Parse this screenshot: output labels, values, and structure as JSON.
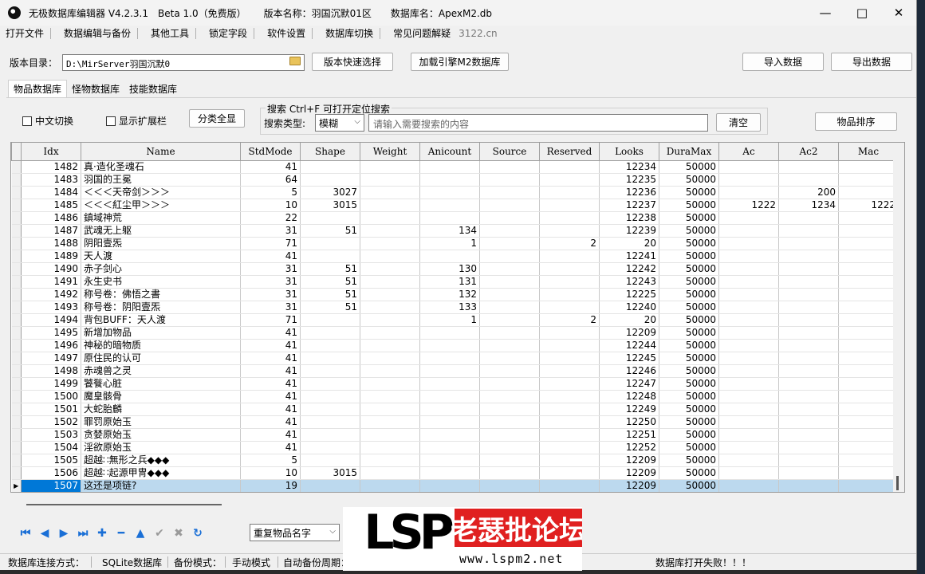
{
  "window": {
    "title_app": "无极数据库编辑器 V4.2.3.1",
    "title_beta": "Beta 1.0（免费版）",
    "title_version": "版本名称：羽国沉默01区",
    "title_db": "数据库名：ApexM2.db"
  },
  "menu": {
    "items": [
      "打开文件",
      "数据编辑与备份",
      "其他工具",
      "锁定字段",
      "软件设置",
      "数据库切换",
      "常见问题解疑"
    ],
    "link": "3122.cn"
  },
  "path": {
    "label": "版本目录：",
    "value": "D:\\MirServer羽国沉默0",
    "quick_select": "版本快速选择",
    "load_engine": "加载引擎M2数据库",
    "import": "导入数据",
    "export": "导出数据"
  },
  "tabs": [
    "物品数据库",
    "怪物数据库",
    "技能数据库"
  ],
  "search": {
    "chinese_toggle": "中文切换",
    "show_ext": "显示扩展栏",
    "category_btn": "分类全显",
    "group_title": "搜索   Ctrl+F 可打开定位搜索",
    "type_label": "搜索类型:",
    "type_value": "模糊",
    "placeholder": "请输入需要搜索的内容",
    "clear": "清空",
    "sort": "物品排序"
  },
  "grid": {
    "columns": [
      "Idx",
      "Name",
      "StdMode",
      "Shape",
      "Weight",
      "Anicount",
      "Source",
      "Reserved",
      "Looks",
      "DuraMax",
      "Ac",
      "Ac2",
      "Mac"
    ],
    "rows": [
      [
        "1482",
        "真·造化圣魂石",
        "41",
        "",
        "",
        "",
        "",
        "",
        "12234",
        "50000",
        "",
        "",
        ""
      ],
      [
        "1483",
        "羽国的王冕",
        "64",
        "",
        "",
        "",
        "",
        "",
        "12235",
        "50000",
        "",
        "",
        ""
      ],
      [
        "1484",
        "＜＜＜天帝剑＞＞＞",
        "5",
        "3027",
        "",
        "",
        "",
        "",
        "12236",
        "50000",
        "",
        "200",
        ""
      ],
      [
        "1485",
        "＜＜＜紅尘甲＞＞＞",
        "10",
        "3015",
        "",
        "",
        "",
        "",
        "12237",
        "50000",
        "1222",
        "1234",
        "1222"
      ],
      [
        "1486",
        "鎮域神荒",
        "22",
        "",
        "",
        "",
        "",
        "",
        "12238",
        "50000",
        "",
        "",
        ""
      ],
      [
        "1487",
        "武魂无上躯",
        "31",
        "51",
        "",
        "134",
        "",
        "",
        "12239",
        "50000",
        "",
        "",
        ""
      ],
      [
        "1488",
        "阴阳壹炁",
        "71",
        "",
        "",
        "1",
        "",
        "2",
        "20",
        "50000",
        "",
        "",
        ""
      ],
      [
        "1489",
        "天人渡",
        "41",
        "",
        "",
        "",
        "",
        "",
        "12241",
        "50000",
        "",
        "",
        ""
      ],
      [
        "1490",
        "赤子剑心",
        "31",
        "51",
        "",
        "130",
        "",
        "",
        "12242",
        "50000",
        "",
        "",
        ""
      ],
      [
        "1491",
        "永生史书",
        "31",
        "51",
        "",
        "131",
        "",
        "",
        "12243",
        "50000",
        "",
        "",
        ""
      ],
      [
        "1492",
        "称号卷：佛悟之書",
        "31",
        "51",
        "",
        "132",
        "",
        "",
        "12225",
        "50000",
        "",
        "",
        ""
      ],
      [
        "1493",
        "称号卷：阴阳壹炁",
        "31",
        "51",
        "",
        "133",
        "",
        "",
        "12240",
        "50000",
        "",
        "",
        ""
      ],
      [
        "1494",
        "背包BUFF：天人渡",
        "71",
        "",
        "",
        "1",
        "",
        "2",
        "20",
        "50000",
        "",
        "",
        ""
      ],
      [
        "1495",
        "新增加物品",
        "41",
        "",
        "",
        "",
        "",
        "",
        "12209",
        "50000",
        "",
        "",
        ""
      ],
      [
        "1496",
        "神秘的暗物质",
        "41",
        "",
        "",
        "",
        "",
        "",
        "12244",
        "50000",
        "",
        "",
        ""
      ],
      [
        "1497",
        "原住民的认可",
        "41",
        "",
        "",
        "",
        "",
        "",
        "12245",
        "50000",
        "",
        "",
        ""
      ],
      [
        "1498",
        "赤魂兽之灵",
        "41",
        "",
        "",
        "",
        "",
        "",
        "12246",
        "50000",
        "",
        "",
        ""
      ],
      [
        "1499",
        "饕餮心脏",
        "41",
        "",
        "",
        "",
        "",
        "",
        "12247",
        "50000",
        "",
        "",
        ""
      ],
      [
        "1500",
        "魔皇骸骨",
        "41",
        "",
        "",
        "",
        "",
        "",
        "12248",
        "50000",
        "",
        "",
        ""
      ],
      [
        "1501",
        "大蛇胎麟",
        "41",
        "",
        "",
        "",
        "",
        "",
        "12249",
        "50000",
        "",
        "",
        ""
      ],
      [
        "1502",
        "罪罚原始玉",
        "41",
        "",
        "",
        "",
        "",
        "",
        "12250",
        "50000",
        "",
        "",
        ""
      ],
      [
        "1503",
        "贪婪原始玉",
        "41",
        "",
        "",
        "",
        "",
        "",
        "12251",
        "50000",
        "",
        "",
        ""
      ],
      [
        "1504",
        "淫欲原始玉",
        "41",
        "",
        "",
        "",
        "",
        "",
        "12252",
        "50000",
        "",
        "",
        ""
      ],
      [
        "1505",
        "超越∷無形之兵◆◆◆",
        "5",
        "",
        "",
        "",
        "",
        "",
        "12209",
        "50000",
        "",
        "",
        ""
      ],
      [
        "1506",
        "超越∷起源甲冑◆◆◆",
        "10",
        "3015",
        "",
        "",
        "",
        "",
        "12209",
        "50000",
        "",
        "",
        ""
      ],
      [
        "1507",
        "这还是项链?",
        "19",
        "",
        "",
        "",
        "",
        "",
        "12209",
        "50000",
        "",
        "",
        ""
      ]
    ],
    "selected_row": 25
  },
  "nav": {
    "icons": [
      "first-icon",
      "prev-icon",
      "next-icon",
      "last-icon",
      "add-icon",
      "remove-icon",
      "up-icon",
      "confirm-icon",
      "cancel-icon",
      "refresh-icon"
    ],
    "dup_select": "重复物品名字"
  },
  "watermark": {
    "logo": "LSP",
    "forum": "老瑟批论坛",
    "url": "www.lspm2.net"
  },
  "status": {
    "conn_label": "数据库连接方式：",
    "conn_value": "SQLite数据库",
    "backup_label": "备份模式：",
    "backup_value": "手动模式",
    "auto_label": "自动备份周期：",
    "message": "数据库打开失败！！！"
  }
}
